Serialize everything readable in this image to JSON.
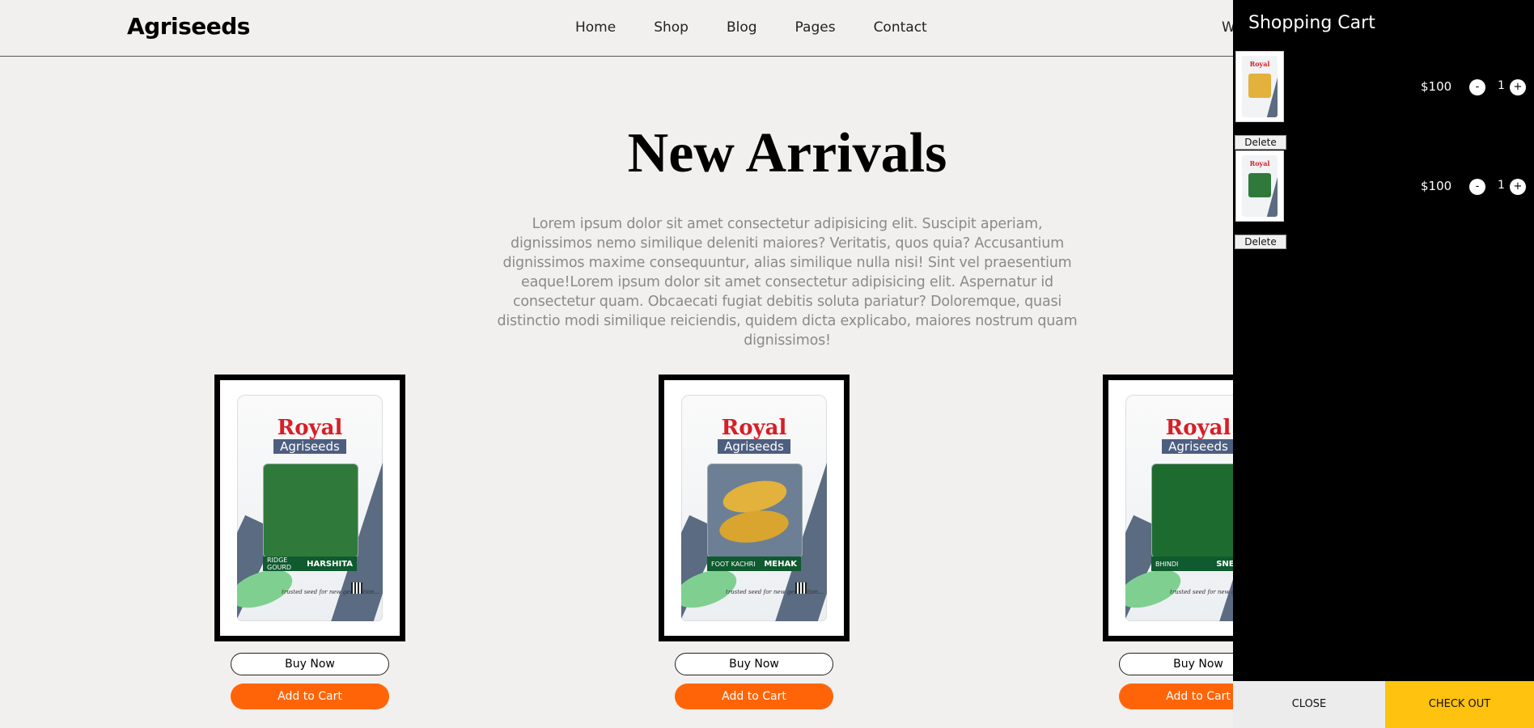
{
  "header": {
    "logo": "Agriseeds",
    "nav": [
      "Home",
      "Shop",
      "Blog",
      "Pages",
      "Contact"
    ],
    "welcome_partial": "W"
  },
  "section": {
    "title": "New Arrivals",
    "description": "Lorem ipsum dolor sit amet consectetur adipisicing elit. Suscipit aperiam, dignissimos nemo similique deleniti maiores? Veritatis, quos quia? Accusantium dignissimos maxime consequuntur, alias similique nulla nisi! Sint vel praesentium eaque!Lorem ipsum dolor sit amet consectetur adipisicing elit. Aspernatur id consectetur quam. Obcaecati fugiat debitis soluta pariatur? Doloremque, quasi distinctio modi similique reiciendis, quidem dicta explicabo, maiores nostrum quam dignissimos!"
  },
  "products": [
    {
      "brand": "Royal",
      "brand_sub": "Agriseeds",
      "crop": "RIDGE GOURD",
      "variety": "HARSHITA",
      "tagline": "trusted seed for new generation...",
      "window_color": "#2f7a3a",
      "buy_label": "Buy Now",
      "cart_label": "Add to Cart"
    },
    {
      "brand": "Royal",
      "brand_sub": "Agriseeds",
      "crop": "FOOT KACHRI",
      "variety": "MEHAK",
      "tagline": "trusted seed for new generation...",
      "window_color": "#e3b23c",
      "buy_label": "Buy Now",
      "cart_label": "Add to Cart"
    },
    {
      "brand": "Royal",
      "brand_sub": "Agriseeds",
      "crop": "BHINDI",
      "variety": "SNEH",
      "tagline": "trusted seed for new generation...",
      "window_color": "#1e6b30",
      "buy_label": "Buy Now",
      "cart_label": "Add to Cart"
    }
  ],
  "cart": {
    "title": "Shopping Cart",
    "items": [
      {
        "price": "$100",
        "qty": "1",
        "minus": "-",
        "plus": "+",
        "delete_label": "Delete",
        "thumb_brand": "Royal",
        "thumb_color": "#e3b23c"
      },
      {
        "price": "$100",
        "qty": "1",
        "minus": "-",
        "plus": "+",
        "delete_label": "Delete",
        "thumb_brand": "Royal",
        "thumb_color": "#2f7a3a"
      }
    ],
    "close_label": "CLOSE",
    "checkout_label": "CHECK OUT"
  },
  "colors": {
    "accent_orange": "#ff6508",
    "checkout_yellow": "#ffc20e",
    "panel_bg": "#000000",
    "page_bg": "#f1f0ee"
  }
}
